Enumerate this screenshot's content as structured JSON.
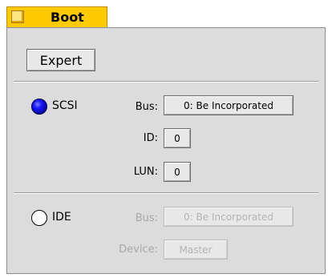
{
  "tab": {
    "label": "Boot",
    "icon": "folder-icon"
  },
  "expert_button": "Expert",
  "scsi": {
    "label": "SCSI",
    "selected": true,
    "bus_label": "Bus:",
    "bus_value": "0: Be Incorporated",
    "id_label": "ID:",
    "id_value": "0",
    "lun_label": "LUN:",
    "lun_value": "0"
  },
  "ide": {
    "label": "IDE",
    "selected": false,
    "bus_label": "Bus:",
    "bus_value": "0: Be Incorporated",
    "device_label": "Device:",
    "device_value": "Master"
  },
  "colors": {
    "tab": "#ffcb00",
    "panel": "#dcdcdc",
    "radio_selected": "#0000c0",
    "disabled_text": "#a8a8a8"
  }
}
